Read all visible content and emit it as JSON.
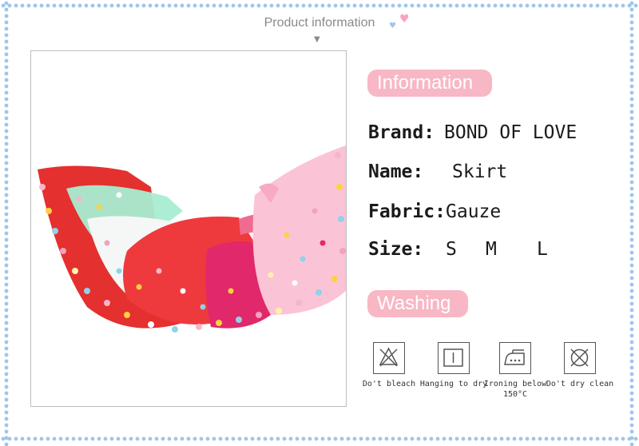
{
  "header": {
    "title": "Product information"
  },
  "info": {
    "heading": "Information",
    "brand_label": "Brand:",
    "brand_value": "BOND OF LOVE",
    "name_label": "Name:",
    "name_value": "Skirt",
    "fabric_label": "Fabric:",
    "fabric_value": "Gauze",
    "size_label": "Size:",
    "sizes": [
      "S",
      "M",
      "L"
    ]
  },
  "washing": {
    "heading": "Washing",
    "items": [
      {
        "icon": "no-bleach-icon",
        "label": "Do't bleach"
      },
      {
        "icon": "hang-dry-icon",
        "label": "Hanging to dry"
      },
      {
        "icon": "iron-icon",
        "label": "Ironing below 150°C"
      },
      {
        "icon": "no-dry-clean-icon",
        "label": "Do't dry clean"
      }
    ]
  },
  "colors": {
    "accent_pink": "#f8b7c4",
    "border_blue": "#9fc6ea"
  }
}
